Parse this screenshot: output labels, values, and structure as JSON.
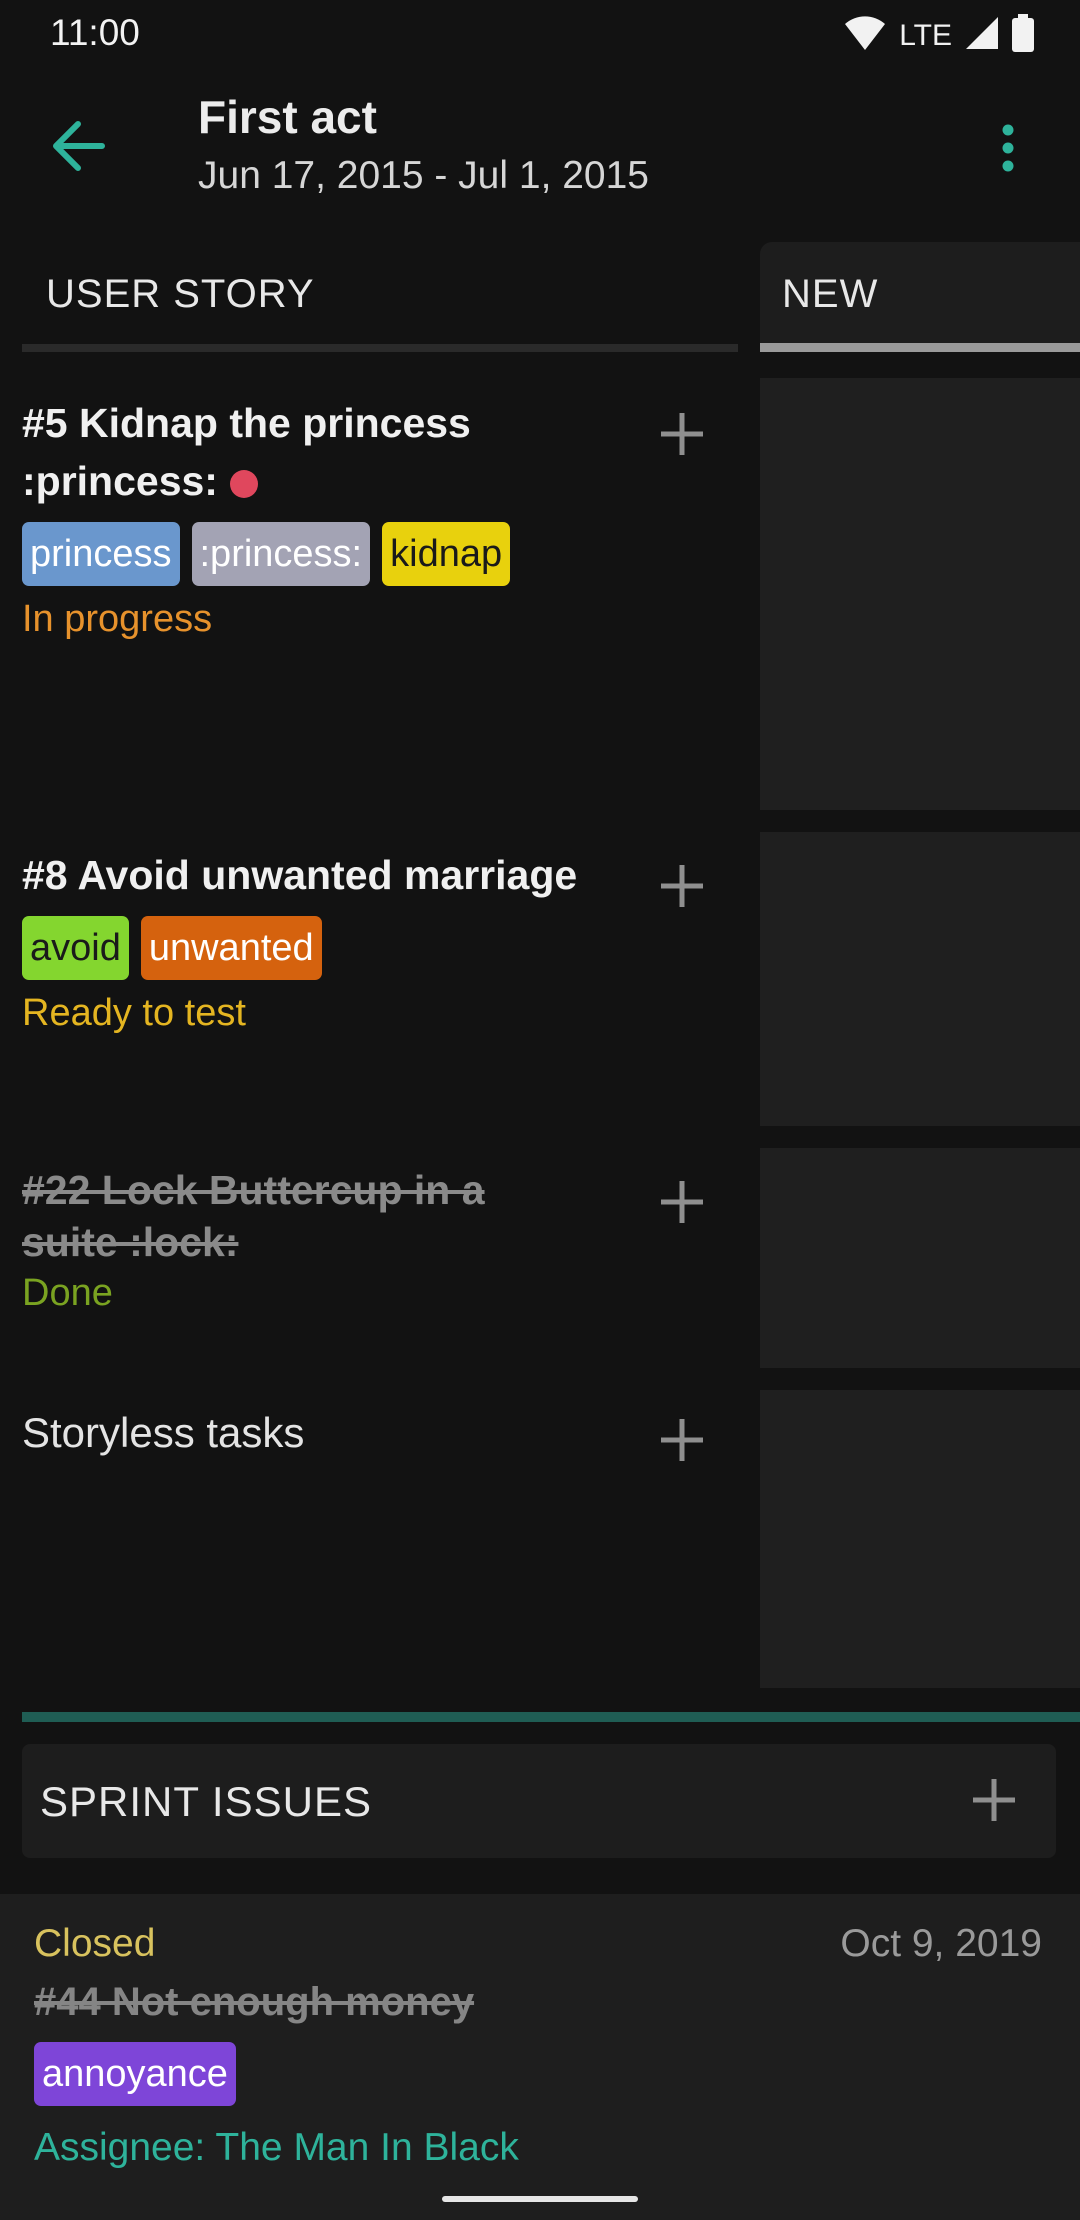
{
  "status_bar": {
    "time": "11:00",
    "network": "LTE",
    "icons": [
      "wifi-icon",
      "signal-icon",
      "battery-icon"
    ]
  },
  "app_bar": {
    "title": "First act",
    "subtitle": "Jun 17, 2015 - Jul 1, 2015",
    "back_icon": "arrow-back-icon",
    "menu_icon": "more-vert-icon"
  },
  "columns": {
    "story_header": "USER STORY",
    "new_header": "NEW"
  },
  "stories": [
    {
      "title": "#5 Kidnap the princess :princess:",
      "has_dot": true,
      "tags": [
        {
          "label": "princess",
          "color": "#6a97cd",
          "text_color": "#ffffff"
        },
        {
          "label": ":princess:",
          "color": "#a3a3b4",
          "text_color": "#ffffff"
        },
        {
          "label": "kidnap",
          "color": "#e8d10d",
          "text_color": "#1a1a1a"
        }
      ],
      "status": "In progress",
      "status_color": "#e7922c"
    },
    {
      "title": "#8 Avoid unwanted marriage",
      "has_dot": false,
      "tags": [
        {
          "label": "avoid",
          "color": "#84d62f",
          "text_color": "#1a1a1a"
        },
        {
          "label": "unwanted",
          "color": "#d5620e",
          "text_color": "#ffffff"
        }
      ],
      "status": "Ready to test",
      "status_color": "#e4b521"
    },
    {
      "title": "#22 Lock Buttercup in a suite :lock:",
      "has_dot": false,
      "tags": [],
      "status": "Done",
      "status_color": "#7aa321"
    },
    {
      "title": "Storyless tasks",
      "has_dot": false,
      "tags": [],
      "status": "",
      "status_color": ""
    }
  ],
  "sprint_issues": {
    "title": "SPRINT ISSUES"
  },
  "issue": {
    "status": "Closed",
    "date": "Oct 9, 2019",
    "title": "#44 Not enough money",
    "tag": "annoyance",
    "tag_color": "#7e45d8",
    "assignee": "Assignee: The Man In Black"
  },
  "colors": {
    "accent": "#2eb39b",
    "background": "#121212",
    "surface": "#1f1f1f"
  }
}
